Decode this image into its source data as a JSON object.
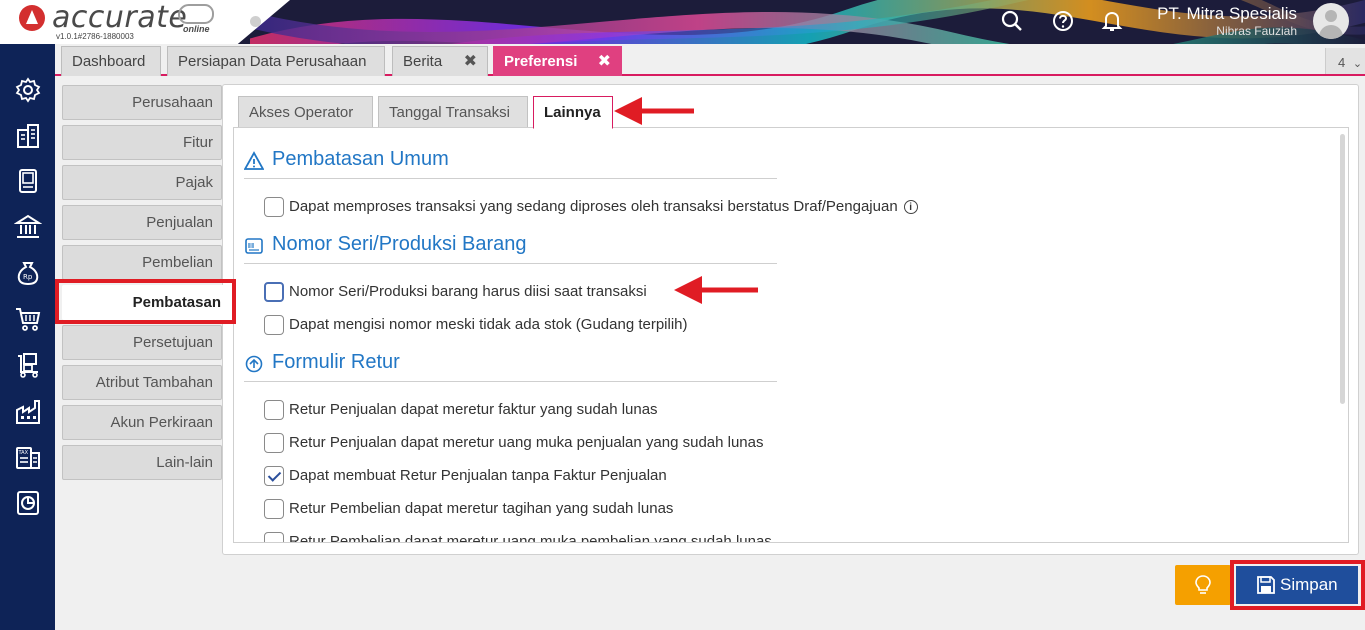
{
  "app": {
    "logo_text": "accurate",
    "logo_sub": "online",
    "version": "v1.0.1#2786-1880003"
  },
  "header": {
    "company": "PT. Mitra Spesialis",
    "user": "Nibras Fauziah",
    "icons": [
      "search-icon",
      "help-icon",
      "bell-icon",
      "avatar"
    ]
  },
  "sidebar": {
    "icons": [
      "gear-icon",
      "building-icon",
      "book-icon",
      "bank-icon",
      "money-bag-icon",
      "cart-icon",
      "stock-icon",
      "factory-icon",
      "tax-icon",
      "report-icon"
    ]
  },
  "tabs": [
    {
      "label": "Dashboard",
      "closable": false
    },
    {
      "label": "Persiapan Data Perusahaan",
      "closable": false
    },
    {
      "label": "Berita",
      "closable": true
    },
    {
      "label": "Preferensi",
      "closable": true,
      "active": true
    }
  ],
  "tab_close": "✖",
  "tab_count": "4",
  "pref_menu": [
    {
      "label": "Perusahaan"
    },
    {
      "label": "Fitur"
    },
    {
      "label": "Pajak"
    },
    {
      "label": "Penjualan"
    },
    {
      "label": "Pembelian"
    },
    {
      "label": "Pembatasan",
      "active": true
    },
    {
      "label": "Persetujuan"
    },
    {
      "label": "Atribut Tambahan"
    },
    {
      "label": "Akun Perkiraan"
    },
    {
      "label": "Lain-lain"
    }
  ],
  "subtabs": [
    {
      "label": "Akses Operator"
    },
    {
      "label": "Tanggal Transaksi"
    },
    {
      "label": "Lainnya",
      "active": true
    }
  ],
  "sections": [
    {
      "title": "Pembatasan Umum",
      "icon": "warning-icon",
      "options": [
        {
          "label": "Dapat memproses transaksi yang sedang diproses oleh transaksi berstatus Draf/Pengajuan",
          "checked": false,
          "info": "i"
        }
      ]
    },
    {
      "title": "Nomor Seri/Produksi Barang",
      "icon": "barcode-icon",
      "options": [
        {
          "label": "Nomor Seri/Produksi barang harus diisi saat transaksi",
          "checked": false
        },
        {
          "label": "Dapat mengisi nomor meski tidak ada stok (Gudang terpilih)",
          "checked": false
        }
      ]
    },
    {
      "title": "Formulir Retur",
      "icon": "return-icon",
      "options": [
        {
          "label": "Retur Penjualan dapat meretur faktur yang sudah lunas",
          "checked": false
        },
        {
          "label": "Retur Penjualan dapat meretur uang muka penjualan yang sudah lunas",
          "checked": false
        },
        {
          "label": "Dapat membuat Retur Penjualan tanpa Faktur Penjualan",
          "checked": true
        },
        {
          "label": "Retur Pembelian dapat meretur tagihan yang sudah lunas",
          "checked": false
        },
        {
          "label": "Retur Pembelian dapat meretur uang muka pembelian yang sudah lunas",
          "checked": false
        }
      ]
    }
  ],
  "buttons": {
    "hint_icon": "lightbulb-icon",
    "save": "Simpan"
  },
  "colors": {
    "accent_pink": "#e04080",
    "sidebar_navy": "#0e2357",
    "section_blue": "#2277c5",
    "save_blue": "#1f4e9c",
    "hint_orange": "#f5a000",
    "annotation_red": "#e01c24"
  }
}
